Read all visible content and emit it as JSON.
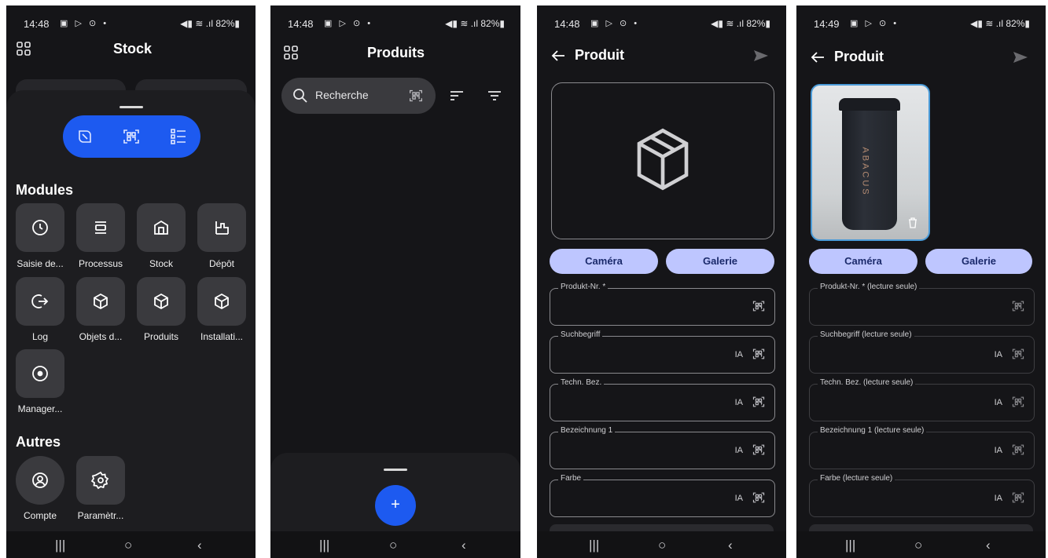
{
  "status_bar": [
    {
      "time": "14:48",
      "icons": "▣ ▷ ⊙ •",
      "right": "◀▮ ≋ .ıl 82%▮"
    },
    {
      "time": "14:48",
      "icons": "▣ ▷ ⊙ •",
      "right": "◀▮ ≋ .ıl 82%▮"
    },
    {
      "time": "14:48",
      "icons": "▣ ▷ ⊙ •",
      "right": "◀▮ ≋ .ıl 82%▮"
    },
    {
      "time": "14:49",
      "icons": "▣ ▷ ⊙ •",
      "right": "◀▮ ≋ .ıl 82%▮"
    }
  ],
  "nav_bar": {
    "recent": "|||",
    "home": "○",
    "back": "‹"
  },
  "screen_stock": {
    "title": "Stock",
    "segmented": [
      "nfc-icon",
      "qr-scan-icon",
      "list-icon"
    ],
    "modules_heading": "Modules",
    "modules": [
      {
        "label": "Saisie de...",
        "icon": "clock-icon"
      },
      {
        "label": "Processus",
        "icon": "process-icon"
      },
      {
        "label": "Stock",
        "icon": "warehouse-icon"
      },
      {
        "label": "Dépôt",
        "icon": "depot-icon"
      },
      {
        "label": "Log",
        "icon": "logout-icon"
      },
      {
        "label": "Objets d...",
        "icon": "cube-icon"
      },
      {
        "label": "Produits",
        "icon": "cube-icon"
      },
      {
        "label": "Installati...",
        "icon": "cube-icon"
      },
      {
        "label": "Manager...",
        "icon": "target-icon"
      }
    ],
    "others_heading": "Autres",
    "others": [
      {
        "label": "Compte",
        "icon": "account-icon"
      },
      {
        "label": "Paramètr...",
        "icon": "settings-icon"
      }
    ]
  },
  "screen_produits": {
    "title": "Produits",
    "search_placeholder": "Recherche",
    "fab_label": "+"
  },
  "screen_produit_new": {
    "title": "Produit",
    "camera_label": "Caméra",
    "gallery_label": "Galerie",
    "fields": [
      {
        "label": "Produkt-Nr. *",
        "ia": ""
      },
      {
        "label": "Suchbegriff",
        "ia": "IA"
      },
      {
        "label": "Techn. Bez.",
        "ia": "IA"
      },
      {
        "label": "Bezeichnung 1",
        "ia": "IA"
      },
      {
        "label": "Farbe",
        "ia": "IA"
      }
    ]
  },
  "screen_produit_photo": {
    "title": "Produit",
    "photo_brand_text": "ABACUS",
    "camera_label": "Caméra",
    "gallery_label": "Galerie",
    "fields": [
      {
        "label": "Produkt-Nr. * (lecture seule)",
        "ia": ""
      },
      {
        "label": "Suchbegriff (lecture seule)",
        "ia": "IA"
      },
      {
        "label": "Techn. Bez. (lecture seule)",
        "ia": "IA"
      },
      {
        "label": "Bezeichnung 1 (lecture seule)",
        "ia": "IA"
      },
      {
        "label": "Farbe (lecture seule)",
        "ia": "IA"
      }
    ]
  },
  "colors": {
    "accent": "#1d5af0",
    "pill": "#bec6ff",
    "background": "#151518"
  }
}
